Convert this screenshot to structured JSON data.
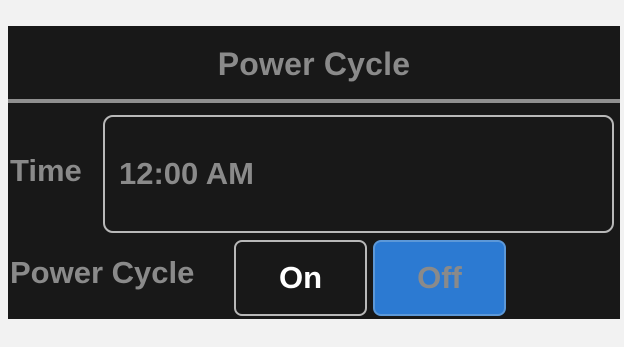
{
  "header": {
    "title": "Power Cycle"
  },
  "time": {
    "label": "Time",
    "value": "12:00 AM"
  },
  "power_cycle": {
    "label": "Power Cycle",
    "options": [
      {
        "label": "On",
        "selected": false
      },
      {
        "label": "Off",
        "selected": true
      }
    ]
  },
  "colors": {
    "panel_background": "#181818",
    "text_gray": "#8a8a8a",
    "selected_accent": "#2c7ad2"
  }
}
